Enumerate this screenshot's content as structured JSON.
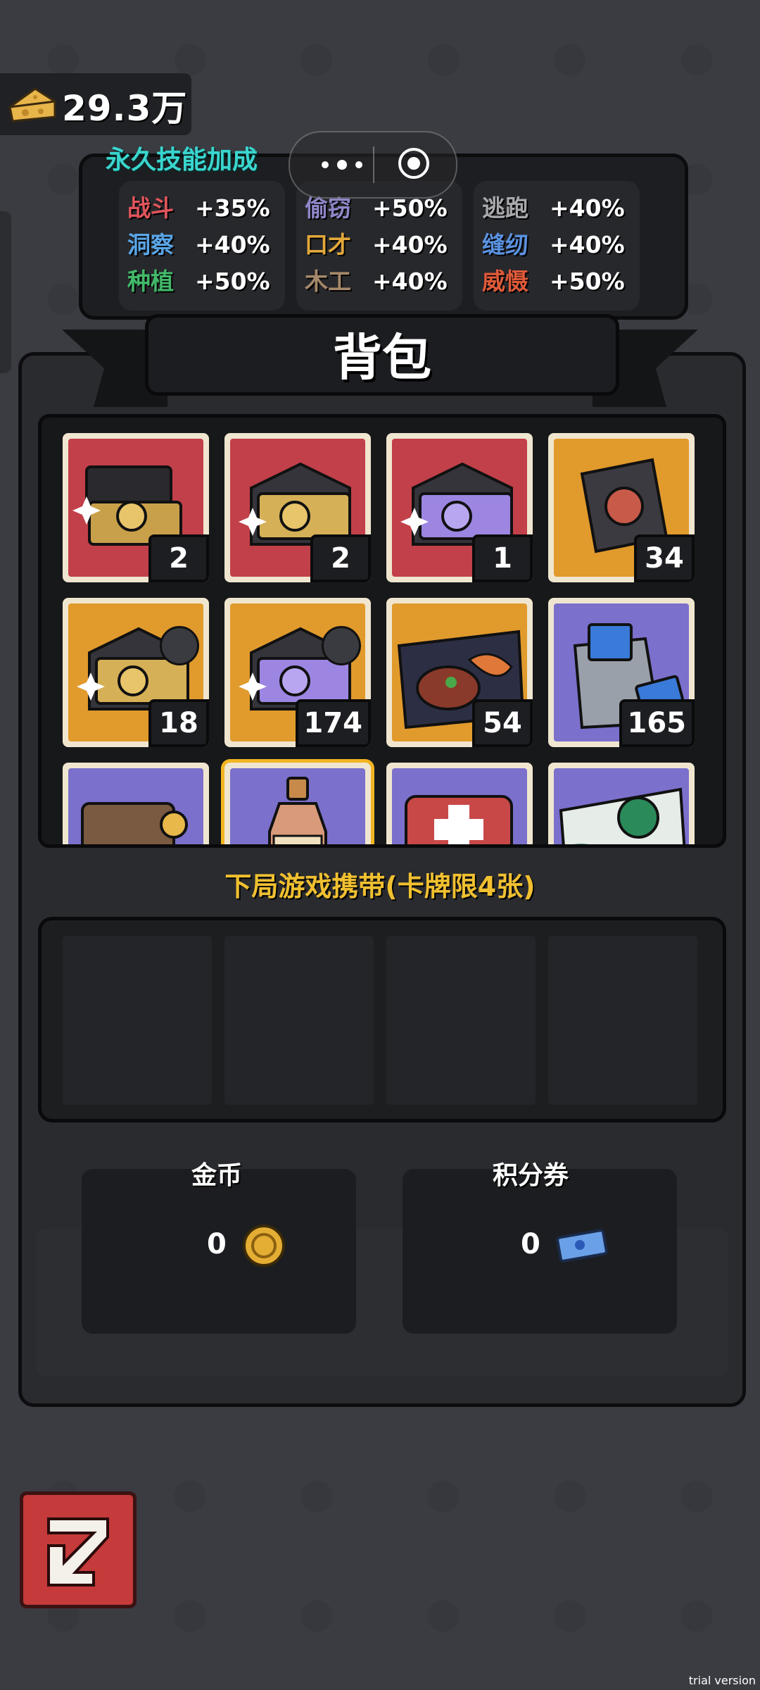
{
  "currency_top": {
    "icon": "cheese-icon",
    "value": "29.3万"
  },
  "skills": {
    "title": "永久技能加成",
    "columns": [
      [
        {
          "name": "战斗",
          "value": "+35%",
          "color": "#e2555c"
        },
        {
          "name": "洞察",
          "value": "+40%",
          "color": "#5aa6e8"
        },
        {
          "name": "种植",
          "value": "+50%",
          "color": "#42b86a"
        }
      ],
      [
        {
          "name": "偷窃",
          "value": "+50%",
          "color": "#8f86c9"
        },
        {
          "name": "口才",
          "value": "+40%",
          "color": "#e2a83a"
        },
        {
          "name": "木工",
          "value": "+40%",
          "color": "#a5896a"
        }
      ],
      [
        {
          "name": "逃跑",
          "value": "+40%",
          "color": "#a9a9ad"
        },
        {
          "name": "缝纫",
          "value": "+40%",
          "color": "#5a92e0"
        },
        {
          "name": "威慑",
          "value": "+50%",
          "color": "#e05a3a"
        }
      ]
    ]
  },
  "backpack": {
    "title": "背包",
    "items": [
      {
        "icon": "gold-card-box-icon",
        "bg": "red",
        "count": "2"
      },
      {
        "icon": "gold-card-envelope-icon",
        "bg": "red",
        "count": "2"
      },
      {
        "icon": "purple-card-envelope-icon",
        "bg": "red",
        "count": "1"
      },
      {
        "icon": "card-pack-icon",
        "bg": "orange",
        "count": "34"
      },
      {
        "icon": "gold-card-envelope-plus-icon",
        "bg": "orange",
        "count": "18"
      },
      {
        "icon": "purple-card-envelope-plus-icon",
        "bg": "orange",
        "count": "174"
      },
      {
        "icon": "steak-icon",
        "bg": "orange",
        "count": "54"
      },
      {
        "icon": "ticket-bag-icon",
        "bg": "purple",
        "count": "165"
      },
      {
        "icon": "wallet-icon",
        "bg": "purple",
        "count": ""
      },
      {
        "icon": "bottle-icon",
        "bg": "purple",
        "count": ""
      },
      {
        "icon": "medkit-icon",
        "bg": "purple",
        "count": ""
      },
      {
        "icon": "virus-card-icon",
        "bg": "purple",
        "count": ""
      }
    ]
  },
  "carry": {
    "label": "下局游戏携带(卡牌限4张)"
  },
  "wallet": {
    "gold": {
      "label": "金币",
      "value": "0"
    },
    "points": {
      "label": "积分券",
      "value": "0"
    }
  },
  "watermark": "trial version"
}
